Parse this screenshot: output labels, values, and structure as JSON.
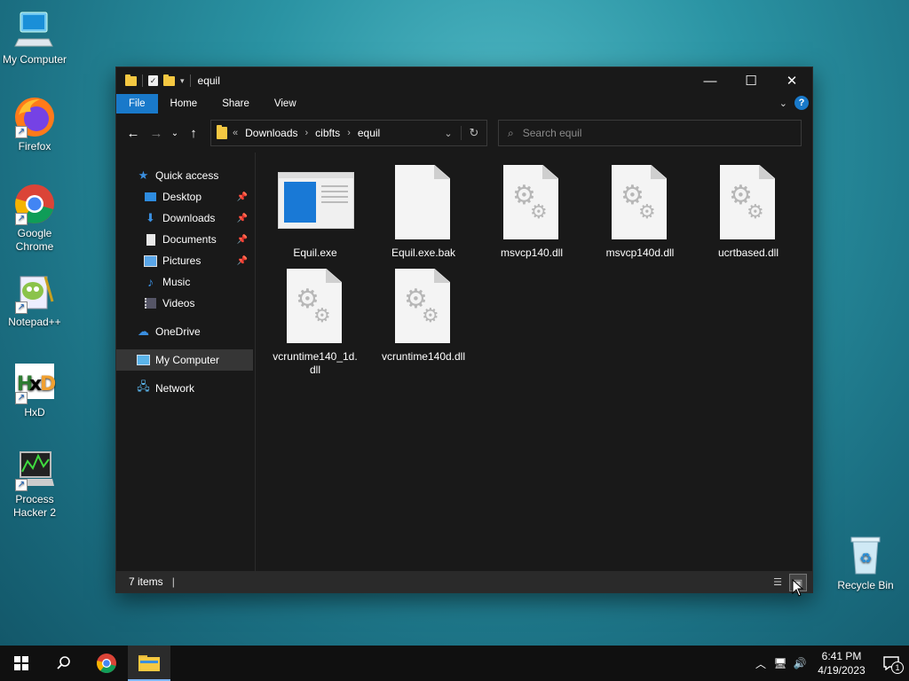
{
  "desktop": {
    "icons": [
      {
        "label": "My Computer"
      },
      {
        "label": "Firefox"
      },
      {
        "label": "Google Chrome"
      },
      {
        "label": "Notepad++"
      },
      {
        "label": "HxD"
      },
      {
        "label": "Process Hacker 2"
      },
      {
        "label": "Recycle Bin"
      }
    ]
  },
  "window": {
    "title": "equil",
    "ribbon_tabs": [
      "File",
      "Home",
      "Share",
      "View"
    ],
    "address": {
      "overflow": "«",
      "crumbs": [
        "Downloads",
        "cibfts",
        "equil"
      ]
    },
    "search_placeholder": "Search equil",
    "sidebar": {
      "quick_access": "Quick access",
      "items": [
        "Desktop",
        "Downloads",
        "Documents",
        "Pictures",
        "Music",
        "Videos"
      ],
      "onedrive": "OneDrive",
      "my_computer": "My Computer",
      "network": "Network"
    },
    "files": [
      {
        "name": "Equil.exe",
        "type": "exe"
      },
      {
        "name": "Equil.exe.bak",
        "type": "blank"
      },
      {
        "name": "msvcp140.dll",
        "type": "dll"
      },
      {
        "name": "msvcp140d.dll",
        "type": "dll"
      },
      {
        "name": "ucrtbased.dll",
        "type": "dll"
      },
      {
        "name": "vcruntime140_1d.dll",
        "type": "dll"
      },
      {
        "name": "vcruntime140d.dll",
        "type": "dll"
      }
    ],
    "status": "7 items"
  },
  "taskbar": {
    "time": "6:41 PM",
    "date": "4/19/2023",
    "notification_count": "1"
  },
  "colors": {
    "accent": "#1979ca",
    "window_bg": "#191919",
    "folder": "#f5c842"
  }
}
